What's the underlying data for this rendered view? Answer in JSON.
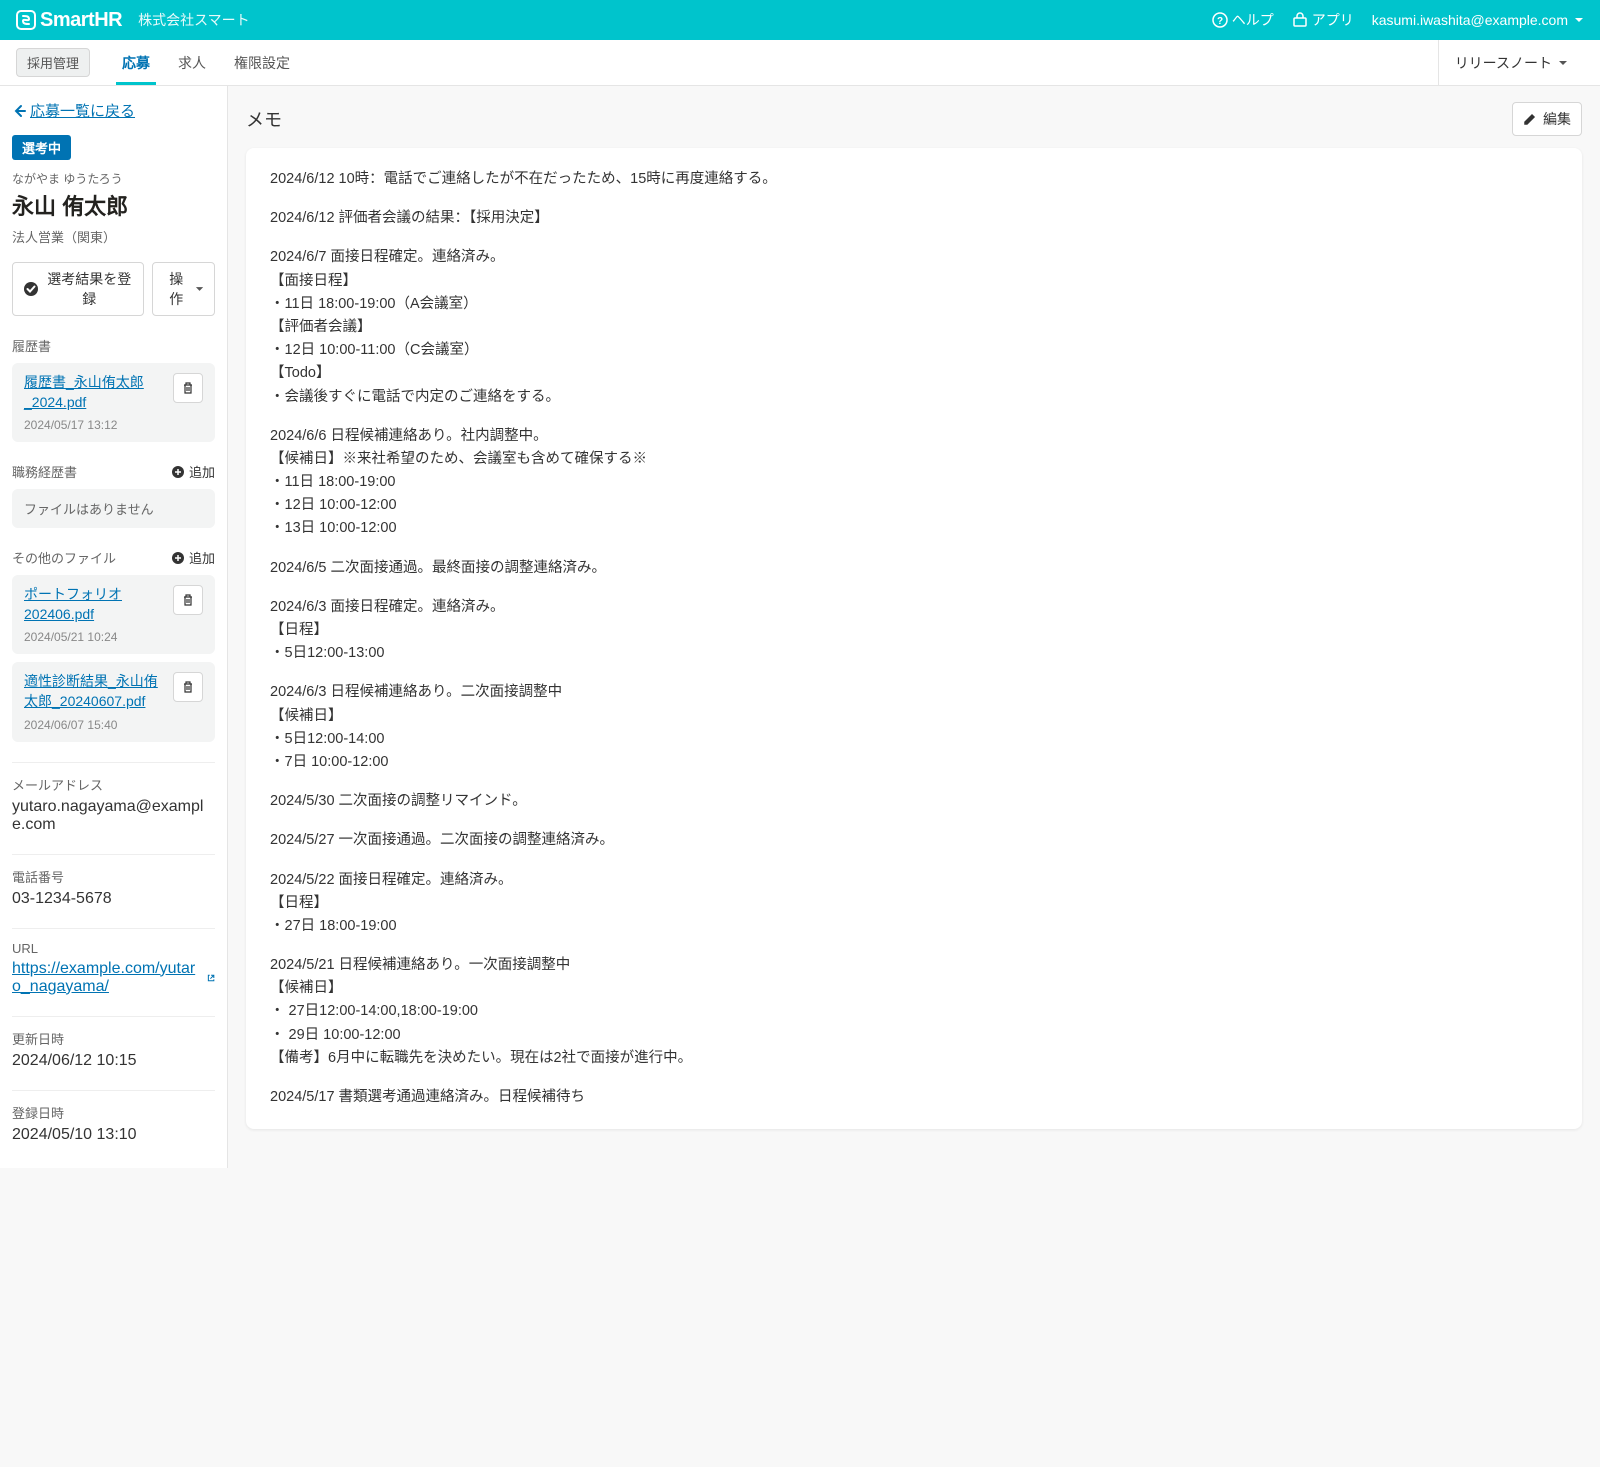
{
  "topbar": {
    "product": "SmartHR",
    "company": "株式会社スマート",
    "help": "ヘルプ",
    "apps": "アプリ",
    "user": "kasumi.iwashita@example.com"
  },
  "nav": {
    "pill": "採用管理",
    "tabs": [
      "応募",
      "求人",
      "権限設定"
    ],
    "activeIndex": 0,
    "release_notes": "リリースノート"
  },
  "sidebar": {
    "back": "応募一覧に戻る",
    "status": "選考中",
    "reading": "ながやま ゆうたろう",
    "name": "永山 侑太郎",
    "position": "法人営業（関東）",
    "register_result": "選考結果を登録",
    "operate": "操作",
    "sections": {
      "resume": {
        "label": "履歴書"
      },
      "work_history": {
        "label": "職務経歴書",
        "add": "追加",
        "empty": "ファイルはありません"
      },
      "other_files": {
        "label": "その他のファイル",
        "add": "追加"
      }
    },
    "resume_files": [
      {
        "name": "履歴書_永山侑太郎_2024.pdf",
        "ts": "2024/05/17 13:12"
      }
    ],
    "other_files": [
      {
        "name": "ポートフォリオ202406.pdf",
        "ts": "2024/05/21  10:24"
      },
      {
        "name": "適性診断結果_永山侑太郎_20240607.pdf",
        "ts": "2024/06/07  15:40"
      }
    ],
    "email": {
      "label": "メールアドレス",
      "value": "yutaro.nagayama@example.com"
    },
    "phone": {
      "label": "電話番号",
      "value": "03-1234-5678"
    },
    "url": {
      "label": "URL",
      "value": "https://example.com/yutaro_nagayama/"
    },
    "updated": {
      "label": "更新日時",
      "value": "2024/06/12 10:15"
    },
    "created": {
      "label": "登録日時",
      "value": "2024/05/10 13:10"
    }
  },
  "memo": {
    "title": "メモ",
    "edit": "編集",
    "lines": [
      "2024/6/12 10時：電話でご連絡したが不在だったため、15時に再度連絡する。",
      "",
      "2024/6/12 評価者会議の結果：【採用決定】",
      "",
      "2024/6/7 面接日程確定。連絡済み。",
      "【面接日程】",
      "・11日 18:00-19:00（A会議室）",
      "【評価者会議】",
      "・12日 10:00-11:00（C会議室）",
      "【Todo】",
      "・会議後すぐに電話で内定のご連絡をする。",
      "",
      "2024/6/6 日程候補連絡あり。社内調整中。",
      "【候補日】※来社希望のため、会議室も含めて確保する※",
      "・11日 18:00-19:00",
      "・12日 10:00-12:00",
      "・13日 10:00-12:00",
      "",
      "2024/6/5 二次面接通過。最終面接の調整連絡済み。",
      "",
      "2024/6/3 面接日程確定。連絡済み。",
      "【日程】",
      "・5日12:00-13:00",
      "",
      "2024/6/3 日程候補連絡あり。二次面接調整中",
      "【候補日】",
      "・5日12:00-14:00",
      "・7日 10:00-12:00",
      "",
      "2024/5/30 二次面接の調整リマインド。",
      "",
      "2024/5/27 一次面接通過。二次面接の調整連絡済み。",
      "",
      "2024/5/22 面接日程確定。連絡済み。",
      "【日程】",
      "・27日 18:00-19:00",
      "",
      "2024/5/21 日程候補連絡あり。一次面接調整中",
      "【候補日】",
      "・ 27日12:00-14:00,18:00-19:00",
      "・ 29日 10:00-12:00",
      "【備考】6月中に転職先を決めたい。現在は2社で面接が進行中。",
      "",
      "2024/5/17 書類選考通過連絡済み。日程候補待ち"
    ]
  }
}
